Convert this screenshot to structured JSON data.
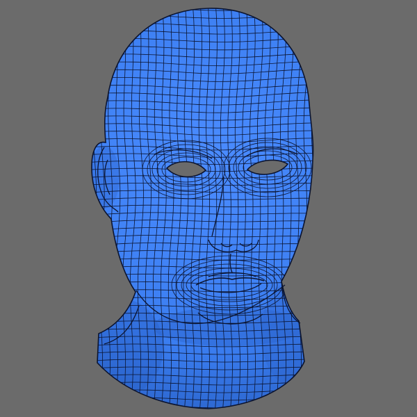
{
  "scene": {
    "background_color": "#6b6b6b",
    "mesh_fill_color": "#3a7df0",
    "mesh_shade_color": "#2a62c8",
    "mesh_highlight_color": "#4b8cff",
    "wire_color": "#0b1430",
    "eye_socket_color": "#6b6b6b",
    "subject": "wireframe-head-mesh"
  }
}
